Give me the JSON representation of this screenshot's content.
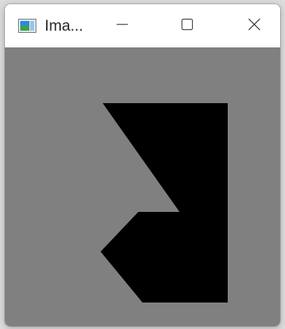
{
  "window": {
    "title": "Ima...",
    "app_icon": "image-window-icon",
    "controls": {
      "minimize_icon": "minimize-icon",
      "maximize_icon": "maximize-icon",
      "close_icon": "close-icon"
    }
  },
  "canvas": {
    "background_color": "#808080",
    "shape_color": "#000000",
    "shape": "black-polygon"
  },
  "colors": {
    "titlebar_bg": "#ffffff",
    "title_text": "#2b2b2b",
    "icon_stroke": "#3a3a3a"
  }
}
